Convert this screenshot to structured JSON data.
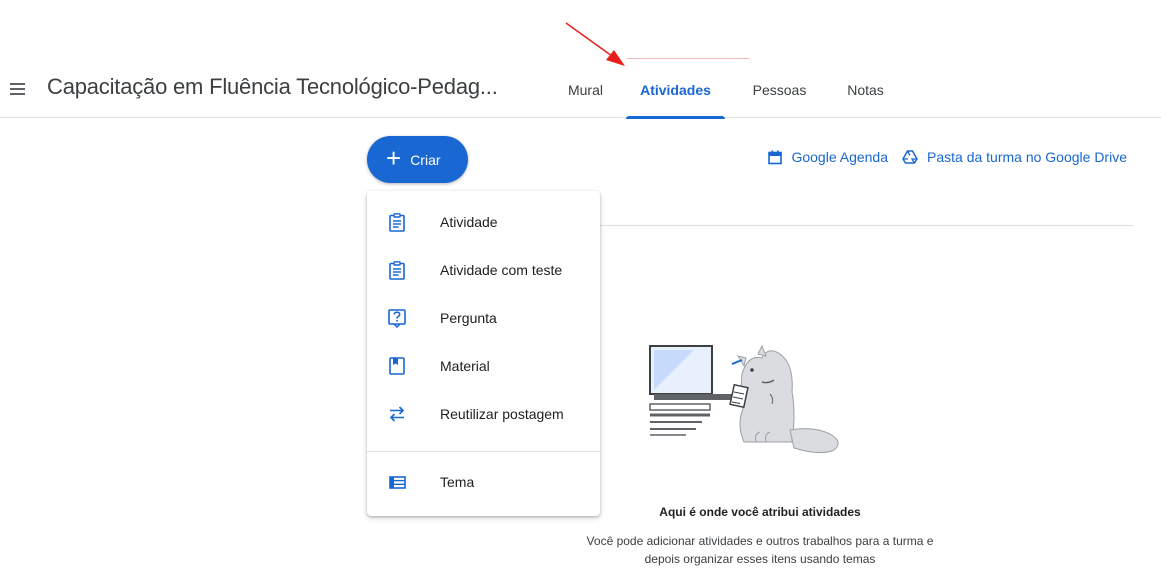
{
  "header": {
    "course_title": "Capacitação em Fluência Tecnológico-Pedag...",
    "tabs": [
      {
        "label": "Mural",
        "active": false
      },
      {
        "label": "Atividades",
        "active": true
      },
      {
        "label": "Pessoas",
        "active": false
      },
      {
        "label": "Notas",
        "active": false
      }
    ]
  },
  "toolbar": {
    "create_label": "Criar",
    "calendar_link": "Google Agenda",
    "drive_link": "Pasta da turma no Google Drive"
  },
  "create_menu": {
    "items": [
      {
        "label": "Atividade",
        "icon": "assignment-icon"
      },
      {
        "label": "Atividade com teste",
        "icon": "quiz-assignment-icon"
      },
      {
        "label": "Pergunta",
        "icon": "question-icon"
      },
      {
        "label": "Material",
        "icon": "material-icon"
      },
      {
        "label": "Reutilizar postagem",
        "icon": "reuse-icon"
      },
      {
        "label": "Tema",
        "icon": "topic-icon"
      }
    ]
  },
  "empty_state": {
    "title": "Aqui é onde você atribui atividades",
    "description": "Você pode adicionar atividades e outros trabalhos para a turma e depois organizar esses itens usando temas"
  },
  "colors": {
    "accent": "#1967d2",
    "annotation_arrow": "#e8201c"
  }
}
